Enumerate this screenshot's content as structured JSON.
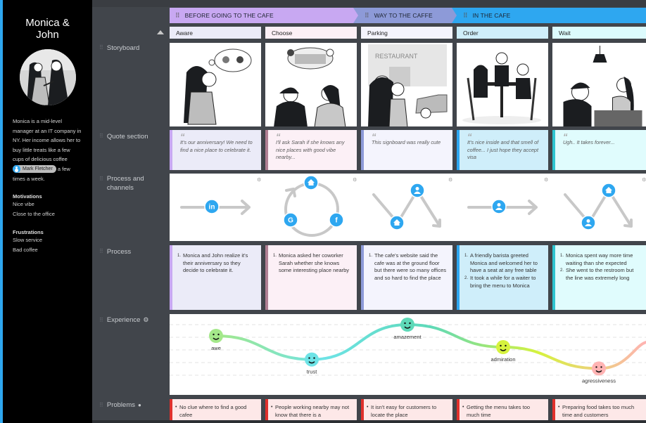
{
  "persona": {
    "name": "Monica & John",
    "bio_before": "Monica is a mid-level manager at an IT company in NY. Her income allows her to buy little treats like a few cups of delicious coffee",
    "mention": "Mark Fletcher",
    "bio_after": "a few times a week.",
    "motivations_title": "Motivations",
    "motivations": [
      "Nice vibe",
      "Close to the office"
    ],
    "frustrations_title": "Frustrations",
    "frustrations": [
      "Slow service",
      "Bad coffee"
    ]
  },
  "phases": [
    {
      "label": "BEFORE GOING TO THE CAFE",
      "color": "#c8a8f2"
    },
    {
      "label": "WAY TO THE CAFFE",
      "color": "#8d9ad8"
    },
    {
      "label": "IN THE CAFE",
      "color": "#2ea7f0"
    }
  ],
  "rows": {
    "storyboard": "Storyboard",
    "quote": "Quote section",
    "channels": "Process and channels",
    "process": "Process",
    "experience": "Experience",
    "problems": "Problems"
  },
  "stages": [
    {
      "name": "Aware",
      "header_bg": "#ebebf8",
      "cell_bg": "#ebebf8",
      "bar": "#c8a8f2",
      "quote": "It's our anniversary! We need to find a nice place to celebrate it.",
      "process": [
        "Monica and John realize it's their anniversary so they decide to celebrate it."
      ],
      "problem": "No clue where to find a good cafee",
      "channel": {
        "pattern": "arrow",
        "icons": [
          "linkedin-icon"
        ]
      }
    },
    {
      "name": "Choose",
      "header_bg": "#fcf0f6",
      "cell_bg": "#fcf0f6",
      "bar": "#b07f93",
      "quote": "I'll ask Sarah if she knows any nice places with good vibe  nearby...",
      "process": [
        "Monica asked her coworker Sarah whether she knows some interesting  place nearby"
      ],
      "problem": "People working nearby may not know that there is a",
      "channel": {
        "pattern": "cycle",
        "icons": [
          "home-icon",
          "facebook-icon",
          "google-icon"
        ]
      }
    },
    {
      "name": "Parking",
      "header_bg": "#f4f4fd",
      "cell_bg": "#f4f4fd",
      "bar": "#8d9ad8",
      "quote": "This signboard was really cute",
      "process": [
        "The cafe's website said the cafe was at the ground floor but there were so many offices and so hard to find the place"
      ],
      "problem": "It isn't easy for customers to locate the place",
      "channel": {
        "pattern": "zigzag",
        "icons": [
          "home-icon",
          "user-icon"
        ]
      }
    },
    {
      "name": "Order",
      "header_bg": "#cfeefa",
      "cell_bg": "#cfeefa",
      "bar": "#2ea7f0",
      "quote": "It's nice inside and that smell of coffee... I just hope they accept visa",
      "process": [
        "A friendly barista greeted Monica and welcomed her to have a seat at any free table",
        "It took a while for a waiter to bring the menu to Monica"
      ],
      "problem": "Getting the menu takes too much time",
      "channel": {
        "pattern": "arrow",
        "icons": [
          "user-icon"
        ]
      }
    },
    {
      "name": "Wait",
      "header_bg": "#dcfbfd",
      "cell_bg": "#e0fcfd",
      "bar": "#2ec4d0",
      "quote": "Ugh.. It takes forever...",
      "process": [
        "Monica spent way more time waiting than she expected",
        "She went to the restroom but the line was extremely long"
      ],
      "problem": "Preparing food takes too much time and customers",
      "channel": {
        "pattern": "zigzag",
        "icons": [
          "user-icon",
          "home-icon"
        ]
      }
    }
  ],
  "experience": {
    "levels": 5,
    "points": [
      {
        "stage": 0,
        "emotion": "awe",
        "level": 3.5,
        "color": "#a4e88a"
      },
      {
        "stage": 1,
        "emotion": "trust",
        "level": 1.4,
        "color": "#6ee3e6"
      },
      {
        "stage": 2,
        "emotion": "amazement",
        "level": 4.5,
        "color": "#5ed9b8"
      },
      {
        "stage": 3,
        "emotion": "admiration",
        "level": 2.5,
        "color": "#d6f23e"
      },
      {
        "stage": 4,
        "emotion": "agressiveness",
        "level": 0.6,
        "color": "#ffb3b3"
      }
    ]
  }
}
